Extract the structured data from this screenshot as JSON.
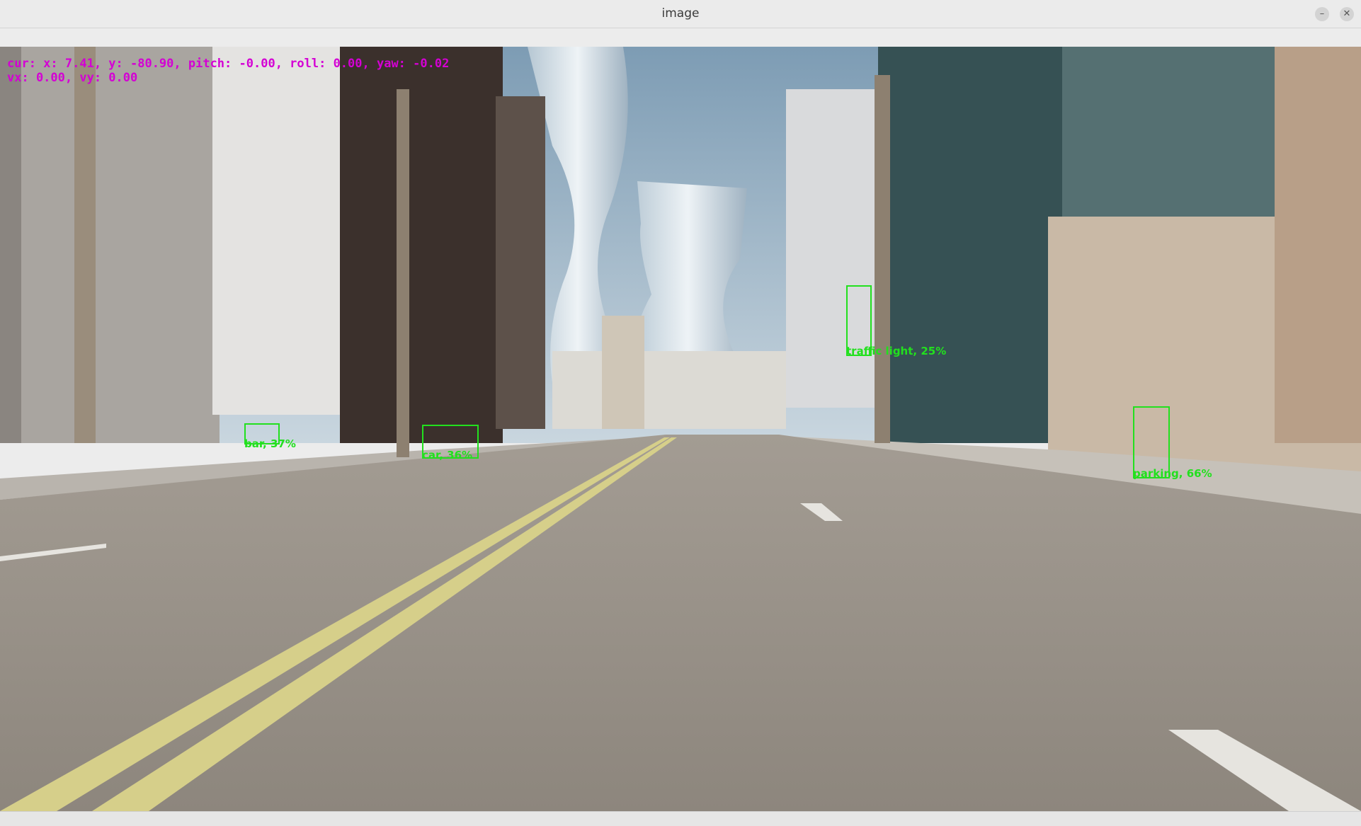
{
  "window": {
    "title": "image",
    "minimize_label": "–",
    "close_label": "✕"
  },
  "hud": {
    "color": "#d400d4",
    "line1": "cur: x: 7.41, y: -80.90, pitch: -0.00, roll: 0.00, yaw: -0.02",
    "line2": "vx: 0.00, vy: 0.00"
  },
  "detections": {
    "color": "#22e01e",
    "items": [
      {
        "label": "bar, 37%"
      },
      {
        "label": "car, 36%"
      },
      {
        "label": "traffic light, 25%"
      },
      {
        "label": "parking, 66%"
      }
    ]
  }
}
